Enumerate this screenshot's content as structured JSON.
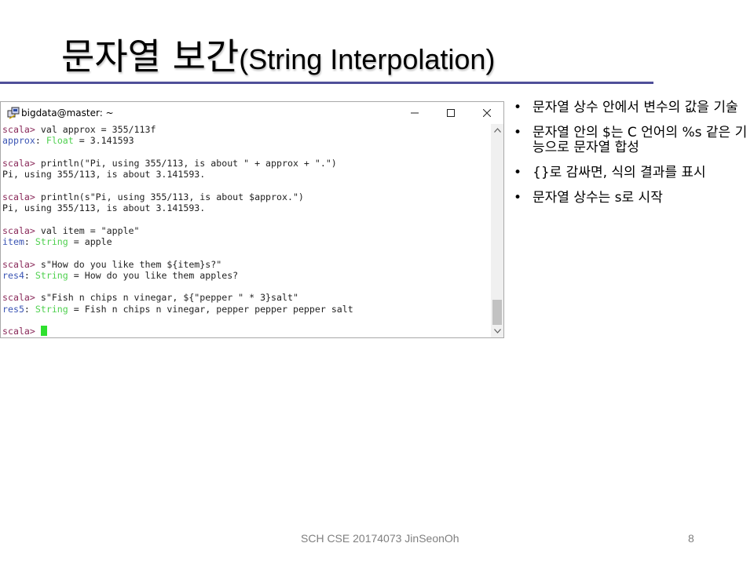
{
  "slide": {
    "title_kr": "문자열 보간",
    "title_en": "(String Interpolation)",
    "footer": "SCH CSE 20174073 JinSeonOh",
    "page_number": "8"
  },
  "window": {
    "title": "bigdata@master: ~",
    "minimize_label": "—",
    "maximize_label": "☐",
    "close_label": "✕"
  },
  "terminal": {
    "prompt": "scala>",
    "lines": [
      {
        "a": "scala>",
        "b": " val approx = 355/113f"
      },
      {
        "a": "approx",
        "b": ": ",
        "c": "Float",
        "d": " = 3.141593"
      },
      {
        "a": "",
        "b": ""
      },
      {
        "a": "scala>",
        "b": " println(\"Pi, using 355/113, is about \" + approx + \".\")"
      },
      {
        "a": "",
        "b": "Pi, using 355/113, is about 3.141593."
      },
      {
        "a": "",
        "b": ""
      },
      {
        "a": "scala>",
        "b": " println(s\"Pi, using 355/113, is about $approx.\")"
      },
      {
        "a": "",
        "b": "Pi, using 355/113, is about 3.141593."
      },
      {
        "a": "",
        "b": ""
      },
      {
        "a": "scala>",
        "b": " val item = \"apple\""
      },
      {
        "a": "item",
        "b": ": ",
        "c": "String",
        "d": " = apple"
      },
      {
        "a": "",
        "b": ""
      },
      {
        "a": "scala>",
        "b": " s\"How do you like them ${item}s?\""
      },
      {
        "a": "res4",
        "b": ": ",
        "c": "String",
        "d": " = How do you like them apples?"
      },
      {
        "a": "",
        "b": ""
      },
      {
        "a": "scala>",
        "b": " s\"Fish n chips n vinegar, ${\"pepper \" * 3}salt\""
      },
      {
        "a": "res5",
        "b": ": ",
        "c": "String",
        "d": " = Fish n chips n vinegar, pepper pepper pepper salt"
      },
      {
        "a": "",
        "b": ""
      }
    ],
    "final_prompt": "scala>"
  },
  "bullets": [
    {
      "text": "문자열 상수 안에서 변수의 값을 기술"
    },
    {
      "text": "문자열 안의 $는 C 언어의 %s 같은 기능으로 문자열 합성"
    },
    {
      "text": "{}로 감싸면, 식의 결과를 표시"
    },
    {
      "text": "문자열 상수는 s로 시작"
    }
  ],
  "bullet_symbol": "•",
  "colors": {
    "prompt": "#8a2a5a",
    "identifier": "#3a54b4",
    "type": "#4fd04f",
    "cursor": "#2ee02e",
    "rule": "#4f4f99"
  }
}
